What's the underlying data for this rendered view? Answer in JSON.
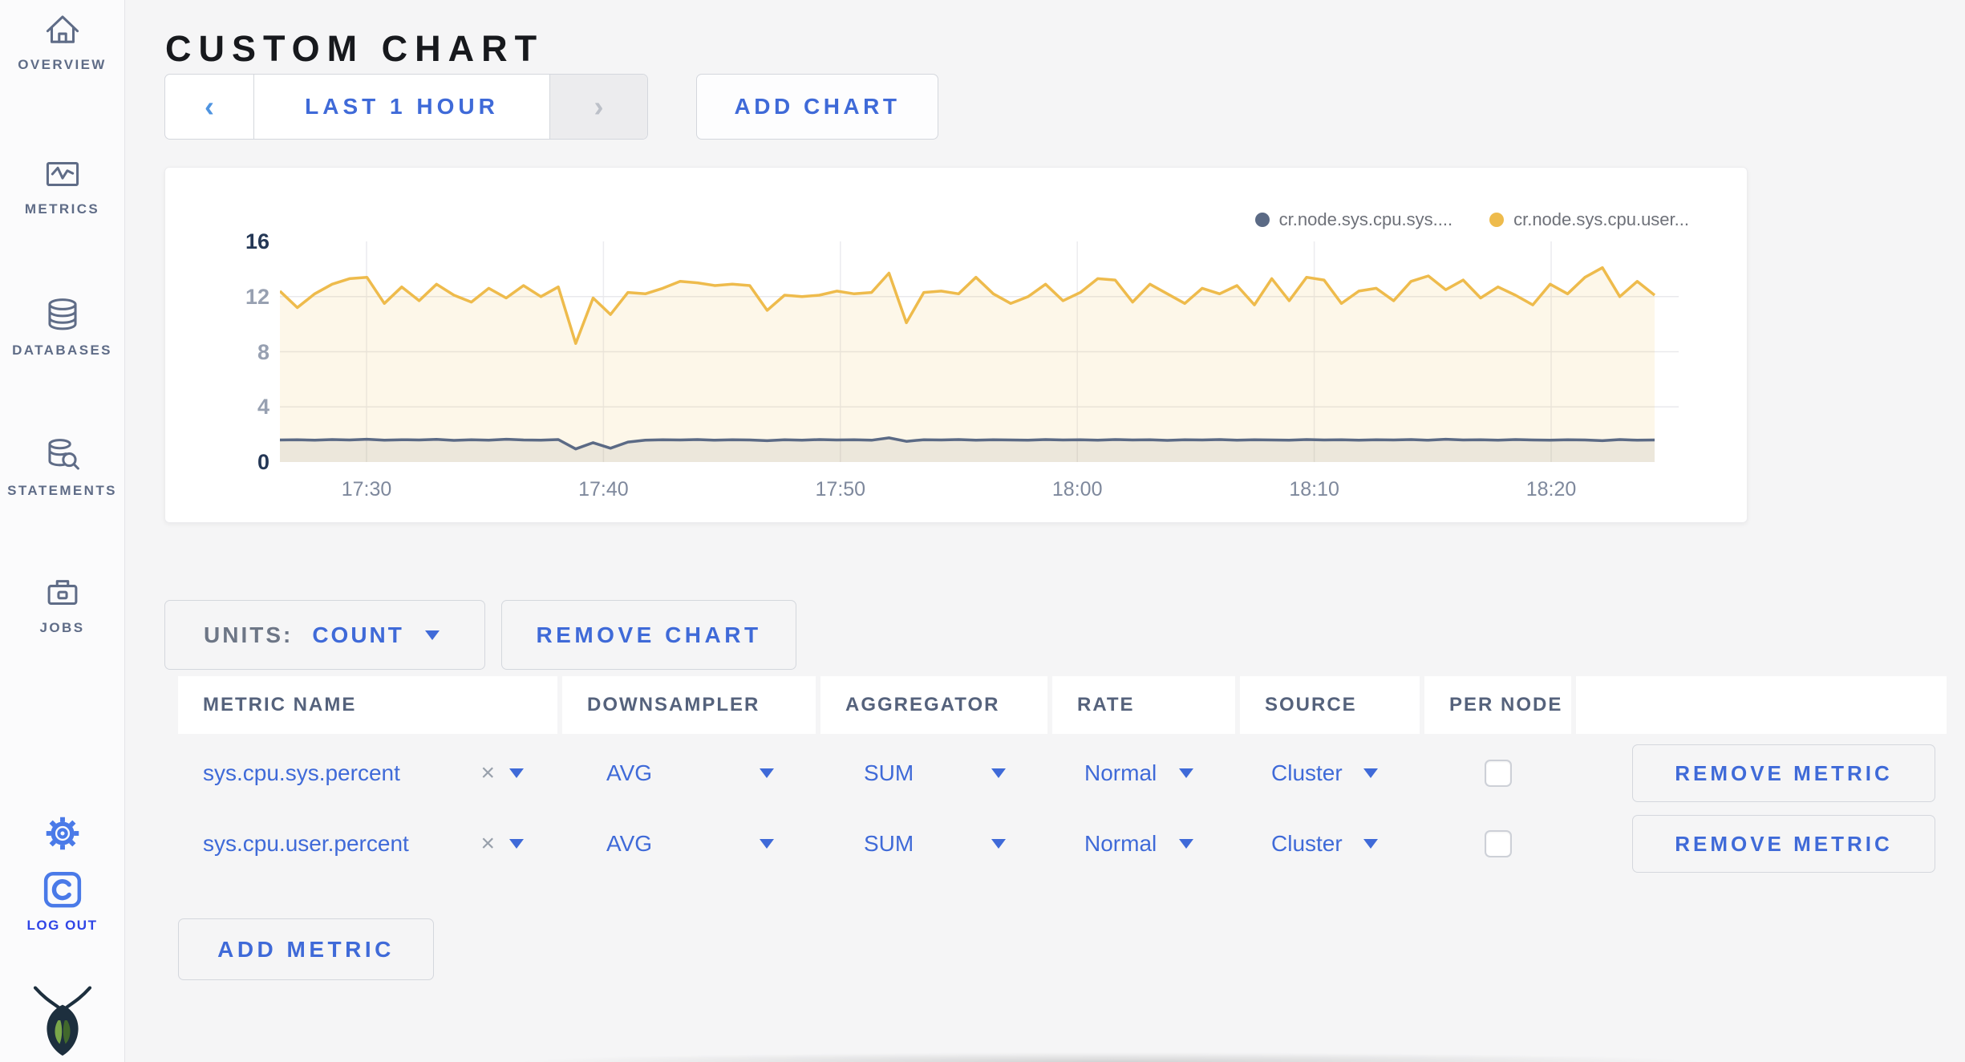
{
  "header": {
    "title": "CUSTOM CHART"
  },
  "sidebar": {
    "items": [
      {
        "label": "OVERVIEW",
        "icon": "home-icon"
      },
      {
        "label": "METRICS",
        "icon": "metrics-icon"
      },
      {
        "label": "DATABASES",
        "icon": "database-icon"
      },
      {
        "label": "STATEMENTS",
        "icon": "statements-icon"
      },
      {
        "label": "JOBS",
        "icon": "jobs-icon"
      }
    ],
    "logout_label": "LOG OUT"
  },
  "toolbar": {
    "prev_arrow": "‹",
    "time_range_label": "LAST 1 HOUR",
    "next_arrow": "›",
    "add_chart_label": "ADD CHART"
  },
  "chart_controls": {
    "units_label": "UNITS:",
    "units_value": "COUNT",
    "remove_chart_label": "REMOVE CHART",
    "add_metric_label": "ADD METRIC"
  },
  "metrics_table": {
    "headers": [
      "METRIC NAME",
      "DOWNSAMPLER",
      "AGGREGATOR",
      "RATE",
      "SOURCE",
      "PER NODE",
      ""
    ],
    "rows": [
      {
        "metric_name": "sys.cpu.sys.percent",
        "clear": "×",
        "downsampler": "AVG",
        "aggregator": "SUM",
        "rate": "Normal",
        "source": "Cluster",
        "per_node_checked": false,
        "remove_label": "REMOVE METRIC"
      },
      {
        "metric_name": "sys.cpu.user.percent",
        "clear": "×",
        "downsampler": "AVG",
        "aggregator": "SUM",
        "rate": "Normal",
        "source": "Cluster",
        "per_node_checked": false,
        "remove_label": "REMOVE METRIC"
      }
    ]
  },
  "chart_data": {
    "type": "area",
    "title": "",
    "xlabel": "",
    "ylabel": "",
    "ylim": [
      0,
      16
    ],
    "y_ticks": [
      0,
      4,
      8,
      12,
      16
    ],
    "x_ticks": [
      "17:30",
      "17:40",
      "17:50",
      "18:00",
      "18:10",
      "18:20"
    ],
    "x_range": [
      "17:26",
      "18:24"
    ],
    "grid": true,
    "legend_position": "top-right",
    "series": [
      {
        "name": "cr.node.sys.cpu.sys....",
        "color": "#5b6a85",
        "fill": "rgba(95,106,125,0.12)",
        "values": [
          1.6,
          1.62,
          1.58,
          1.63,
          1.6,
          1.65,
          1.58,
          1.62,
          1.6,
          1.64,
          1.57,
          1.62,
          1.59,
          1.65,
          1.6,
          1.58,
          1.63,
          0.95,
          1.4,
          1.0,
          1.45,
          1.58,
          1.62,
          1.6,
          1.63,
          1.58,
          1.62,
          1.6,
          1.55,
          1.62,
          1.58,
          1.63,
          1.6,
          1.62,
          1.58,
          1.75,
          1.5,
          1.62,
          1.6,
          1.63,
          1.58,
          1.62,
          1.6,
          1.58,
          1.63,
          1.6,
          1.62,
          1.58,
          1.63,
          1.6,
          1.62,
          1.57,
          1.62,
          1.6,
          1.63,
          1.58,
          1.62,
          1.6,
          1.58,
          1.63,
          1.6,
          1.62,
          1.58,
          1.62,
          1.6,
          1.63,
          1.58,
          1.65,
          1.6,
          1.62,
          1.58,
          1.63,
          1.6,
          1.58,
          1.62,
          1.6,
          1.55,
          1.63,
          1.58,
          1.6
        ]
      },
      {
        "name": "cr.node.sys.cpu.user...",
        "color": "#eebb4c",
        "fill": "rgba(238,187,76,0.12)",
        "values": [
          12.4,
          11.2,
          12.2,
          12.9,
          13.3,
          13.4,
          11.5,
          12.7,
          11.7,
          12.9,
          12.1,
          11.6,
          12.6,
          11.9,
          12.8,
          12.0,
          12.7,
          8.6,
          11.9,
          10.7,
          12.3,
          12.2,
          12.6,
          13.1,
          13.0,
          12.8,
          12.9,
          12.8,
          11.0,
          12.1,
          12.0,
          12.1,
          12.4,
          12.2,
          12.3,
          13.7,
          10.1,
          12.3,
          12.4,
          12.2,
          13.4,
          12.2,
          11.5,
          12.0,
          12.9,
          11.7,
          12.3,
          13.3,
          13.2,
          11.6,
          12.9,
          12.2,
          11.5,
          12.6,
          12.2,
          12.8,
          11.4,
          13.3,
          11.7,
          13.4,
          13.2,
          11.5,
          12.4,
          12.6,
          11.7,
          13.1,
          13.5,
          12.5,
          13.2,
          11.9,
          12.7,
          12.1,
          11.4,
          12.9,
          12.2,
          13.4,
          14.1,
          12.0,
          13.1,
          12.1
        ]
      }
    ]
  },
  "colors": {
    "accent_blue": "#3f6ad8",
    "icon_blue": "#4a7ae8",
    "logout_blue": "#2f45e6",
    "sidebar_text": "#5f6c87",
    "series_sys": "#5b6a85",
    "series_user": "#eebb4c",
    "page_bg": "#f5f5f6",
    "card_bg": "#ffffff"
  }
}
